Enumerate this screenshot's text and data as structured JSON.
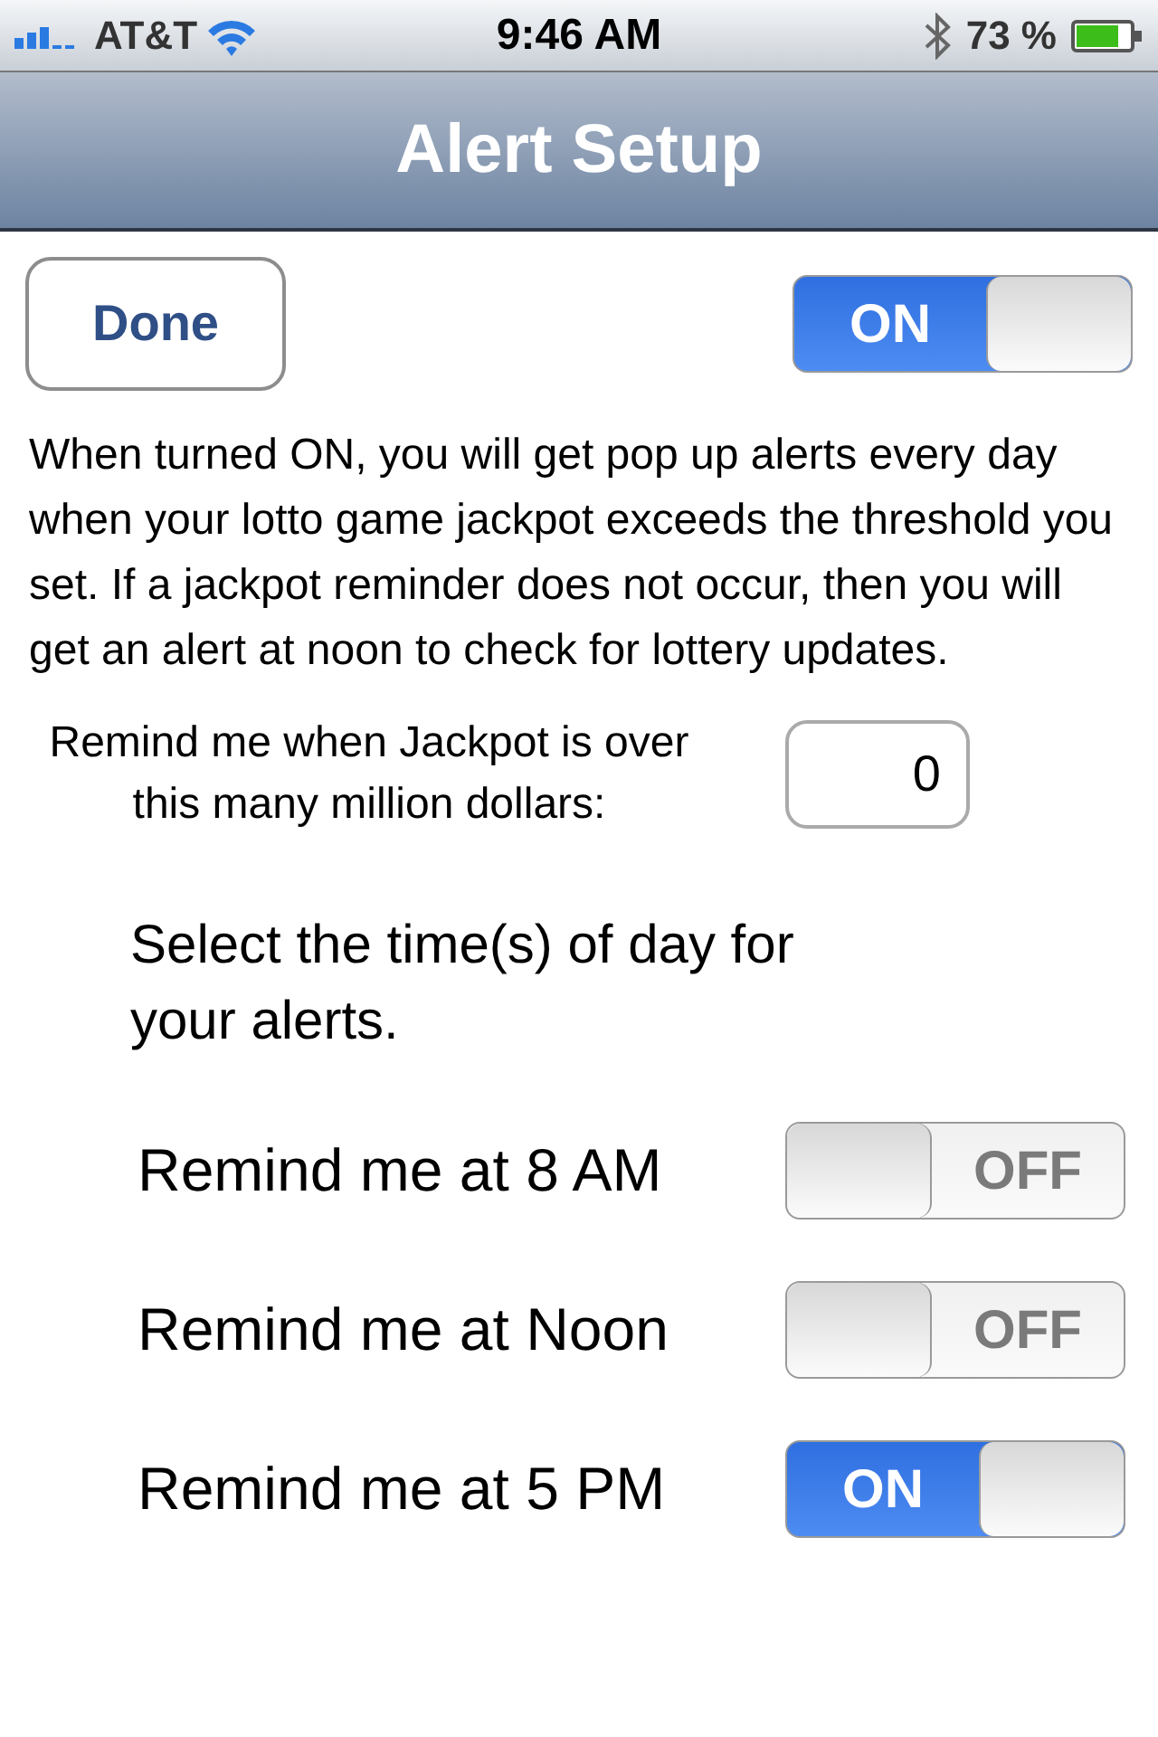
{
  "status_bar": {
    "carrier": "AT&T",
    "time": "9:46 AM",
    "battery": "73 %"
  },
  "nav_bar": {
    "title": "Alert Setup"
  },
  "done_button": "Done",
  "master_switch": {
    "on": true,
    "label": "ON"
  },
  "description": "When turned ON, you will get pop up alerts every day when your lotto game jackpot exceeds the threshold you set. If a jackpot reminder does not occur, then you will get an alert at noon to check for lottery updates.",
  "threshold": {
    "label": "Remind me when Jackpot is over this many million dollars:",
    "value": "0"
  },
  "times_heading": "Select the time(s) of day for your alerts.",
  "reminders": [
    {
      "label": "Remind me at 8 AM",
      "on": false,
      "switch_label": "OFF"
    },
    {
      "label": "Remind me at Noon",
      "on": false,
      "switch_label": "OFF"
    },
    {
      "label": "Remind me at 5 PM",
      "on": true,
      "switch_label": "ON"
    }
  ]
}
